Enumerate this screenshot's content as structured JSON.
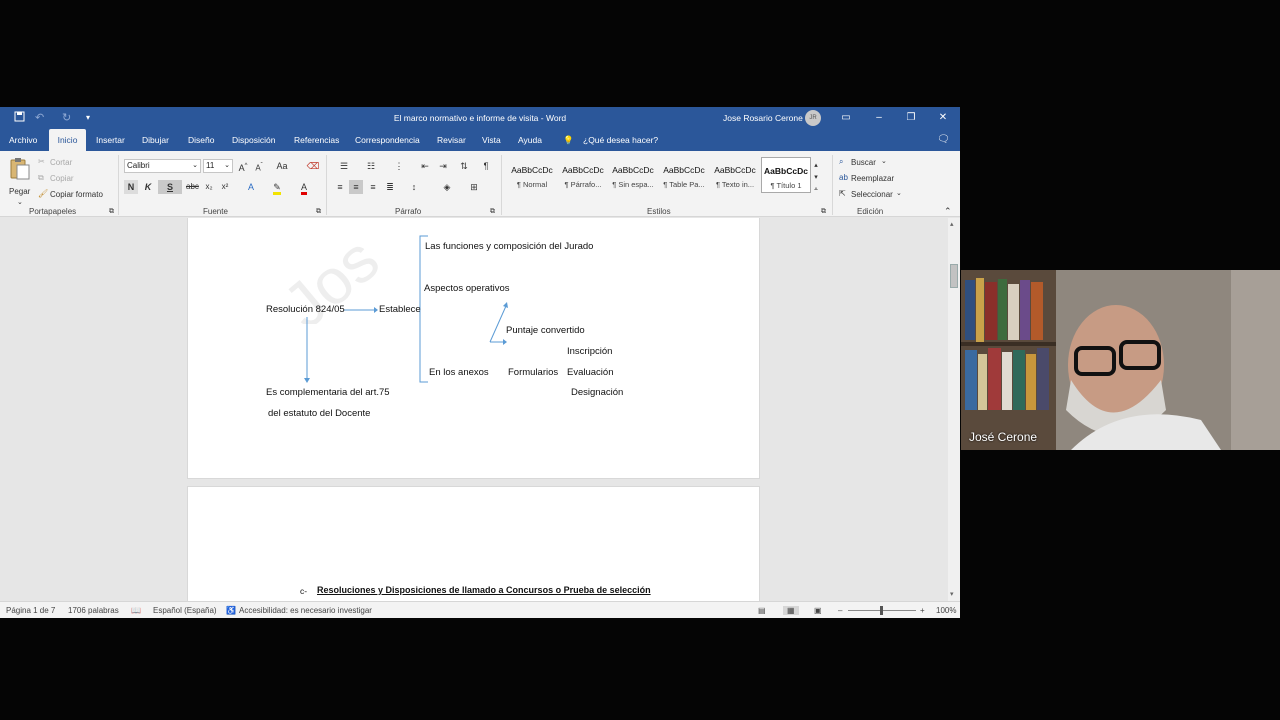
{
  "window": {
    "title": "El marco normativo e informe de visita  -  Word",
    "user": "Jose Rosario Cerone",
    "avatar_initials": "JR"
  },
  "tabs": [
    "Archivo",
    "Inicio",
    "Insertar",
    "Dibujar",
    "Diseño",
    "Disposición",
    "Referencias",
    "Correspondencia",
    "Revisar",
    "Vista",
    "Ayuda"
  ],
  "tell_me": "¿Qué desea hacer?",
  "clipboard": {
    "paste": "Pegar",
    "cut": "Cortar",
    "copy": "Copiar",
    "format_painter": "Copiar formato",
    "label": "Portapapeles"
  },
  "font": {
    "name": "Calibri",
    "size": "11",
    "label": "Fuente",
    "bold": "N",
    "italic": "K",
    "underline": "S",
    "case": "Aa"
  },
  "paragraph": {
    "label": "Párrafo"
  },
  "styles": {
    "label": "Estilos",
    "preview_text": "AaBbCcDc",
    "items": [
      {
        "preview": "AaBbCcDc",
        "name": "¶ Normal"
      },
      {
        "preview": "AaBbCcDc",
        "name": "¶ Párrafo..."
      },
      {
        "preview": "AaBbCcDc",
        "name": "¶ Sin espa..."
      },
      {
        "preview": "AaBbCcDc",
        "name": "¶ Table Pa..."
      },
      {
        "preview": "AaBbCcDc",
        "name": "¶ Texto in..."
      },
      {
        "preview": "AaBbCcDc",
        "name": "¶ Título 1"
      }
    ]
  },
  "editing": {
    "label": "Edición",
    "find": "Buscar",
    "replace": "Reemplazar",
    "select": "Seleccionar"
  },
  "document": {
    "page1": {
      "resolution": "Resolución 824/05",
      "establishes": "Establece",
      "functions": "Las funciones y composición del Jurado",
      "aspects": "Aspectos operativos",
      "score": "Puntaje convertido",
      "registration": "Inscripción",
      "annexes": "En los anexos",
      "forms": "Formularios",
      "evaluation": "Evaluación",
      "designation": "Designación",
      "complementary": "Es complementaria del art.75",
      "statute": "del estatuto  del Docente"
    },
    "page2": {
      "list_marker": "c-",
      "heading": "Resoluciones y Disposiciones de llamado a Concursos o Prueba de selección"
    }
  },
  "status": {
    "page": "Página 1 de 7",
    "words": "1706 palabras",
    "language": "Español (España)",
    "accessibility": "Accesibilidad: es necesario investigar",
    "zoom": "100%"
  },
  "webcam": {
    "name": "José Cerone"
  }
}
